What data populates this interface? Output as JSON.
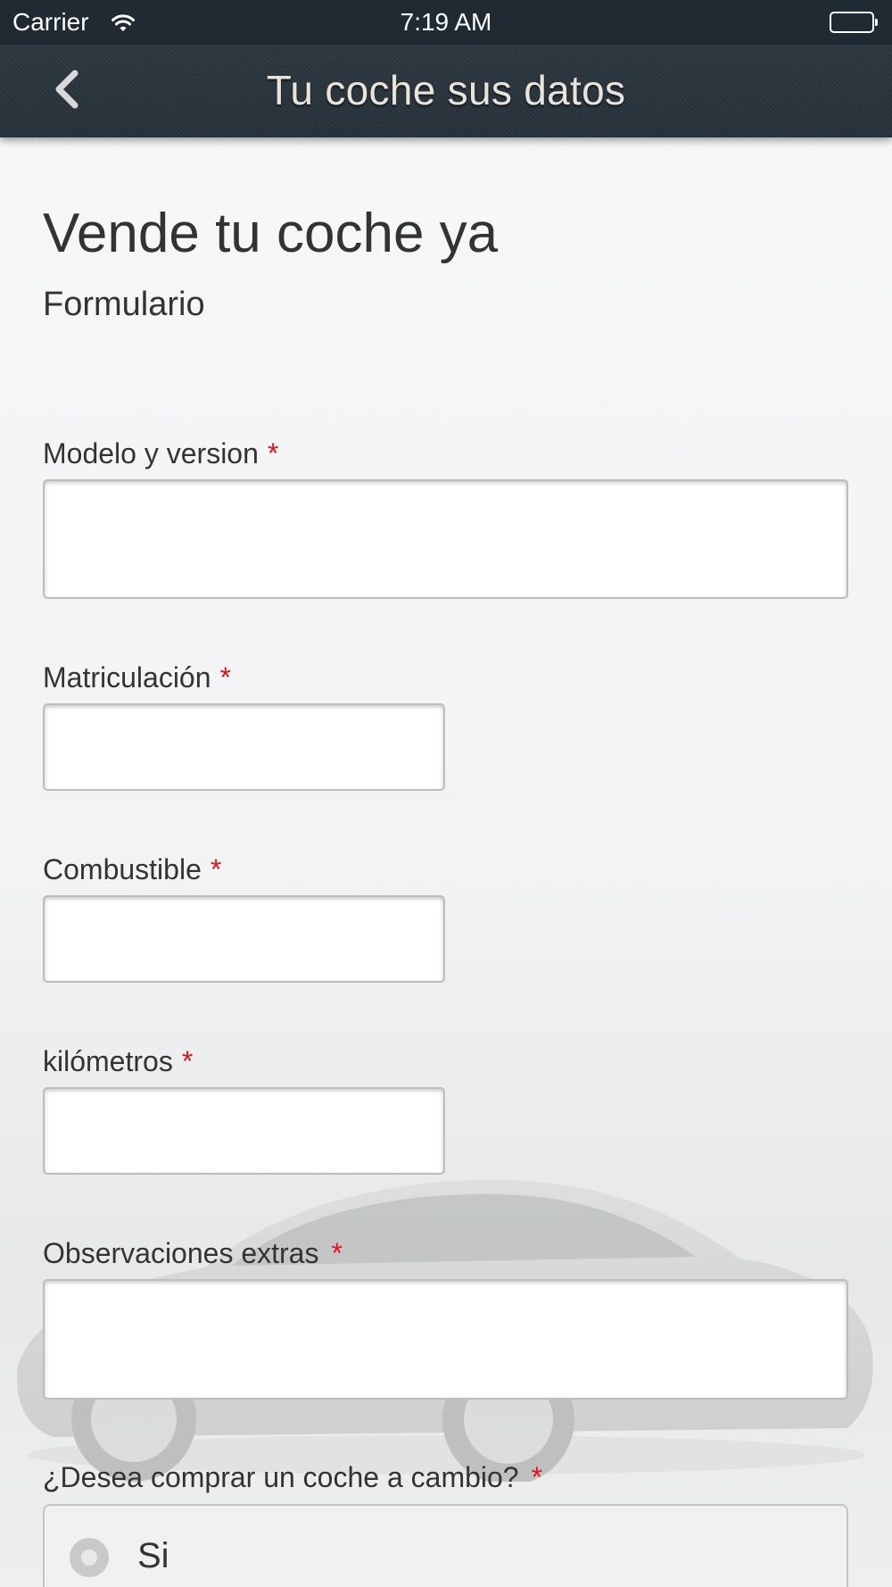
{
  "status_bar": {
    "carrier": "Carrier",
    "time": "7:19 AM",
    "wifi_icon": "wifi-icon",
    "battery_icon": "battery-icon"
  },
  "nav": {
    "back_icon": "chevron-left-icon",
    "title": "Tu coche sus datos"
  },
  "page": {
    "title": "Vende tu coche ya",
    "subtitle": "Formulario"
  },
  "form": {
    "required_marker": "*",
    "fields": [
      {
        "label": "Modelo y version",
        "value": ""
      },
      {
        "label": "Matriculación",
        "value": ""
      },
      {
        "label": "Combustible",
        "value": ""
      },
      {
        "label": "kilómetros",
        "value": ""
      },
      {
        "label": "Observaciones extras",
        "value": ""
      }
    ],
    "question": {
      "label": "¿Desea comprar un coche a cambio?",
      "options": [
        {
          "label": "Si",
          "selected": false
        }
      ]
    }
  },
  "colors": {
    "nav_background": "#26313a",
    "required": "#e0141e",
    "text": "#333333"
  }
}
